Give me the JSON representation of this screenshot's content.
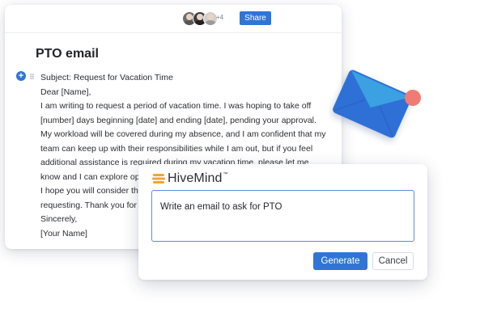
{
  "document": {
    "title": "PTO email",
    "share_label": "Share",
    "collaborators_extra": "+4",
    "lines": [
      "Subject: Request for Vacation Time",
      "Dear [Name],",
      "I am writing to request a period of vacation time. I was hoping to take off",
      "[number] days beginning [date] and ending [date], pending your approval.",
      "My workload will be covered during my absence, and I am confident that my",
      "team can keep up with their responsibilities while I am out, but if you feel",
      "additional assistance is required during my vacation time, please let me",
      "know and I can explore op",
      "I hope you will consider th",
      "requesting. Thank you for",
      "Sincerely,",
      "[Your Name]"
    ]
  },
  "dialog": {
    "brand": "HiveMind",
    "brand_mark": "™",
    "prompt_value": "Write an email to ask for PTO",
    "generate_label": "Generate",
    "cancel_label": "Cancel"
  },
  "colors": {
    "accent": "#2f75d6",
    "envelope": "#2f6fd6",
    "envelope_flap": "#3aa1e2",
    "notification_dot": "#f07b73",
    "brand_icon": "#f2a33a"
  },
  "icons": {
    "add_block": "plus-circle-icon",
    "envelope": "envelope-icon",
    "notification": "notification-dot-icon",
    "brand": "hivemind-logo-icon"
  }
}
